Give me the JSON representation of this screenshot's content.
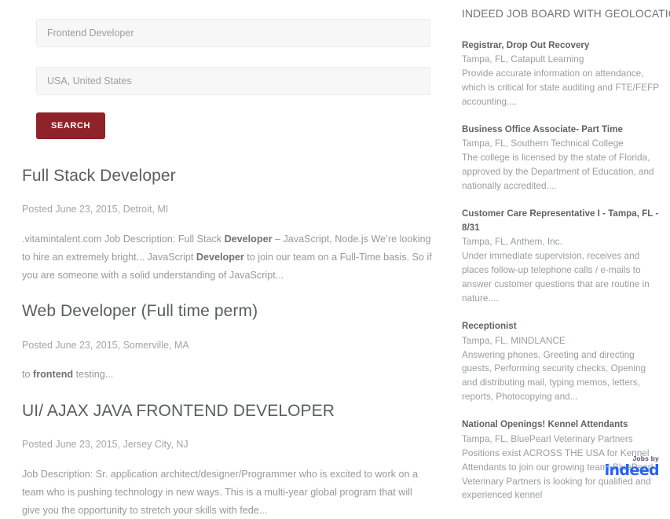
{
  "search_form": {
    "keyword_input": {
      "value": "",
      "placeholder": "Frontend Developer"
    },
    "location_input": {
      "value": "",
      "placeholder": "USA, United States"
    },
    "search_button_label": "SEARCH"
  },
  "results": [
    {
      "title": "Full Stack Developer",
      "meta": "Posted June 23, 2015, Detroit, MI",
      "desc_parts": [
        {
          "text": ".vitamintalent.com Job Description: Full Stack ",
          "bold": false
        },
        {
          "text": "Developer",
          "bold": true
        },
        {
          "text": " – JavaScript, Node.js We’re looking to hire an extremely bright... JavaScript ",
          "bold": false
        },
        {
          "text": "Developer",
          "bold": true
        },
        {
          "text": " to join our team on a Full-Time basis. So if you are someone with a solid understanding of JavaScript...",
          "bold": false
        }
      ]
    },
    {
      "title": "Web Developer (Full time perm)",
      "meta": "Posted June 23, 2015, Somerville, MA",
      "desc_parts": [
        {
          "text": "to ",
          "bold": false
        },
        {
          "text": "frontend",
          "bold": true
        },
        {
          "text": " testing...",
          "bold": false
        }
      ]
    },
    {
      "title": "UI/ AJAX JAVA FRONTEND DEVELOPER",
      "meta": "Posted June 23, 2015, Jersey City, NJ",
      "desc_parts": [
        {
          "text": "Job Description: Sr. application architect/designer/Programmer who is excited to work on a team who is pushing technology in new ways. This is a multi-year global program that will give you the opportunity to stretch your skills with fede...",
          "bold": false
        }
      ]
    }
  ],
  "sidebar": {
    "title": "INDEED JOB BOARD WITH GEOLOCATION",
    "jobs": [
      {
        "title": "Registrar, Drop Out Recovery",
        "location": "Tampa, FL, Catapult Learning",
        "snippet": "Provide accurate information on attendance, which is critical for state auditing and FTE/FEFP accounting...."
      },
      {
        "title": "Business Office Associate- Part Time",
        "location": "Tampa, FL, Southern Technical College",
        "snippet": "The college is licensed by the state of Florida, approved by the Department of Education, and nationally accredited...."
      },
      {
        "title": "Customer Care Representative I - Tampa, FL - 8/31",
        "location": "Tampa, FL, Anthem, Inc.",
        "snippet": "Under immediate supervision, receives and places follow-up telephone calls / e-mails to answer customer questions that are routine in nature...."
      },
      {
        "title": "Receptionist",
        "location": "Tampa, FL, MINDLANCE",
        "snippet": "Answering phones, Greeting and directing guests, Performing security checks, Opening and distributing mail, typing memos, letters, reports, Photocopying and..."
      },
      {
        "title": "National Openings! Kennel Attendants",
        "location": "Tampa, FL, BluePearl Veterinary Partners",
        "snippet": "Positions exist ACROSS THE USA for Kennel Attendants to join our growing team! BluePearl Veterinary Partners is looking for qualified and experienced kennel"
      }
    ],
    "attribution": {
      "jobs_by_label": "Jobs by",
      "brand": "indeed"
    }
  },
  "colors": {
    "search_button": "#8f2329",
    "indeed_blue": "#2164f3",
    "jobs_by": "#5c4a6e",
    "title_text": "#5a5e61",
    "body_text": "#97999b"
  }
}
